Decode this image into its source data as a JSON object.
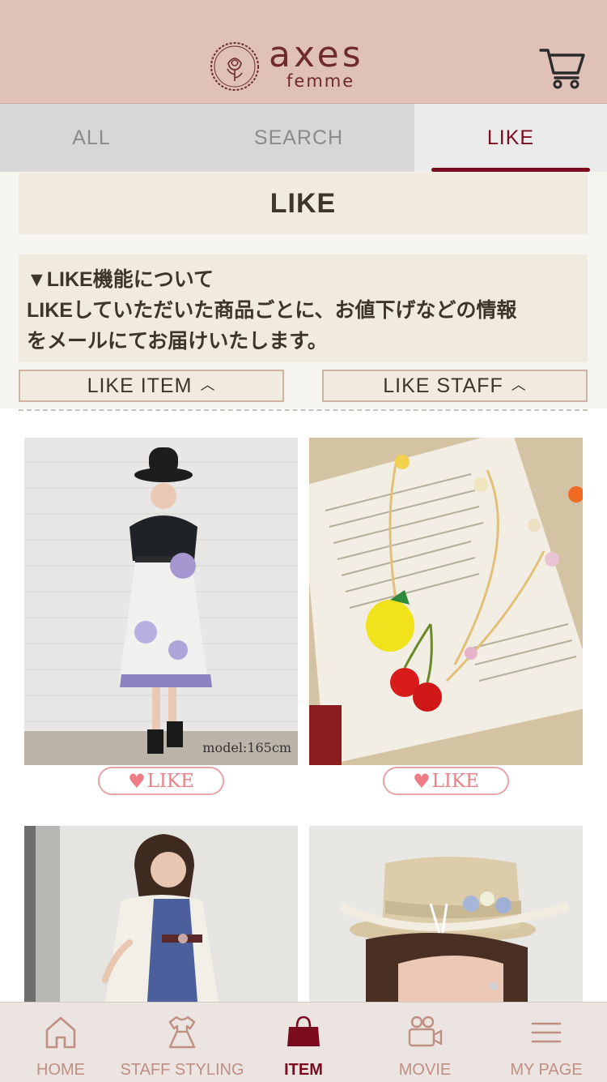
{
  "header": {
    "logo_text": "axes",
    "logo_subtext": "femme"
  },
  "tabs": [
    {
      "label": "ALL",
      "active": false
    },
    {
      "label": "SEARCH",
      "active": false
    },
    {
      "label": "LIKE",
      "active": true
    }
  ],
  "page": {
    "heading": "LIKE",
    "info_lines": [
      "▼LIKE機能について",
      "LIKEしていただいた商品ごとに、お値下げなどの情報",
      "をメールにてお届けいたします。"
    ],
    "toggle_like_item": "LIKE ITEM",
    "toggle_like_staff": "LIKE STAFF"
  },
  "products": [
    {
      "image": "model-black-blouse-floral-skirt",
      "photo_label": "model:165cm",
      "like_label": "LIKE"
    },
    {
      "image": "fruit-necklace-on-book",
      "photo_label": "",
      "like_label": "LIKE"
    },
    {
      "image": "model-navy-dress-lace-cardigan",
      "photo_label": "",
      "like_label": ""
    },
    {
      "image": "straw-boater-hat-with-flowers",
      "photo_label": "",
      "like_label": ""
    }
  ],
  "bottom_nav": [
    {
      "label": "HOME",
      "icon": "home-icon",
      "active": false
    },
    {
      "label": "STAFF STYLING",
      "icon": "dress-icon",
      "active": false
    },
    {
      "label": "ITEM",
      "icon": "bag-icon",
      "active": true
    },
    {
      "label": "MOVIE",
      "icon": "video-camera-icon",
      "active": false
    },
    {
      "label": "MY PAGE",
      "icon": "menu-icon",
      "active": false
    }
  ],
  "colors": {
    "header_bg": "#dfc1b8",
    "brand": "#7b0b1e",
    "like_pink": "#ea8186",
    "panel_beige": "#f1ebdf"
  }
}
